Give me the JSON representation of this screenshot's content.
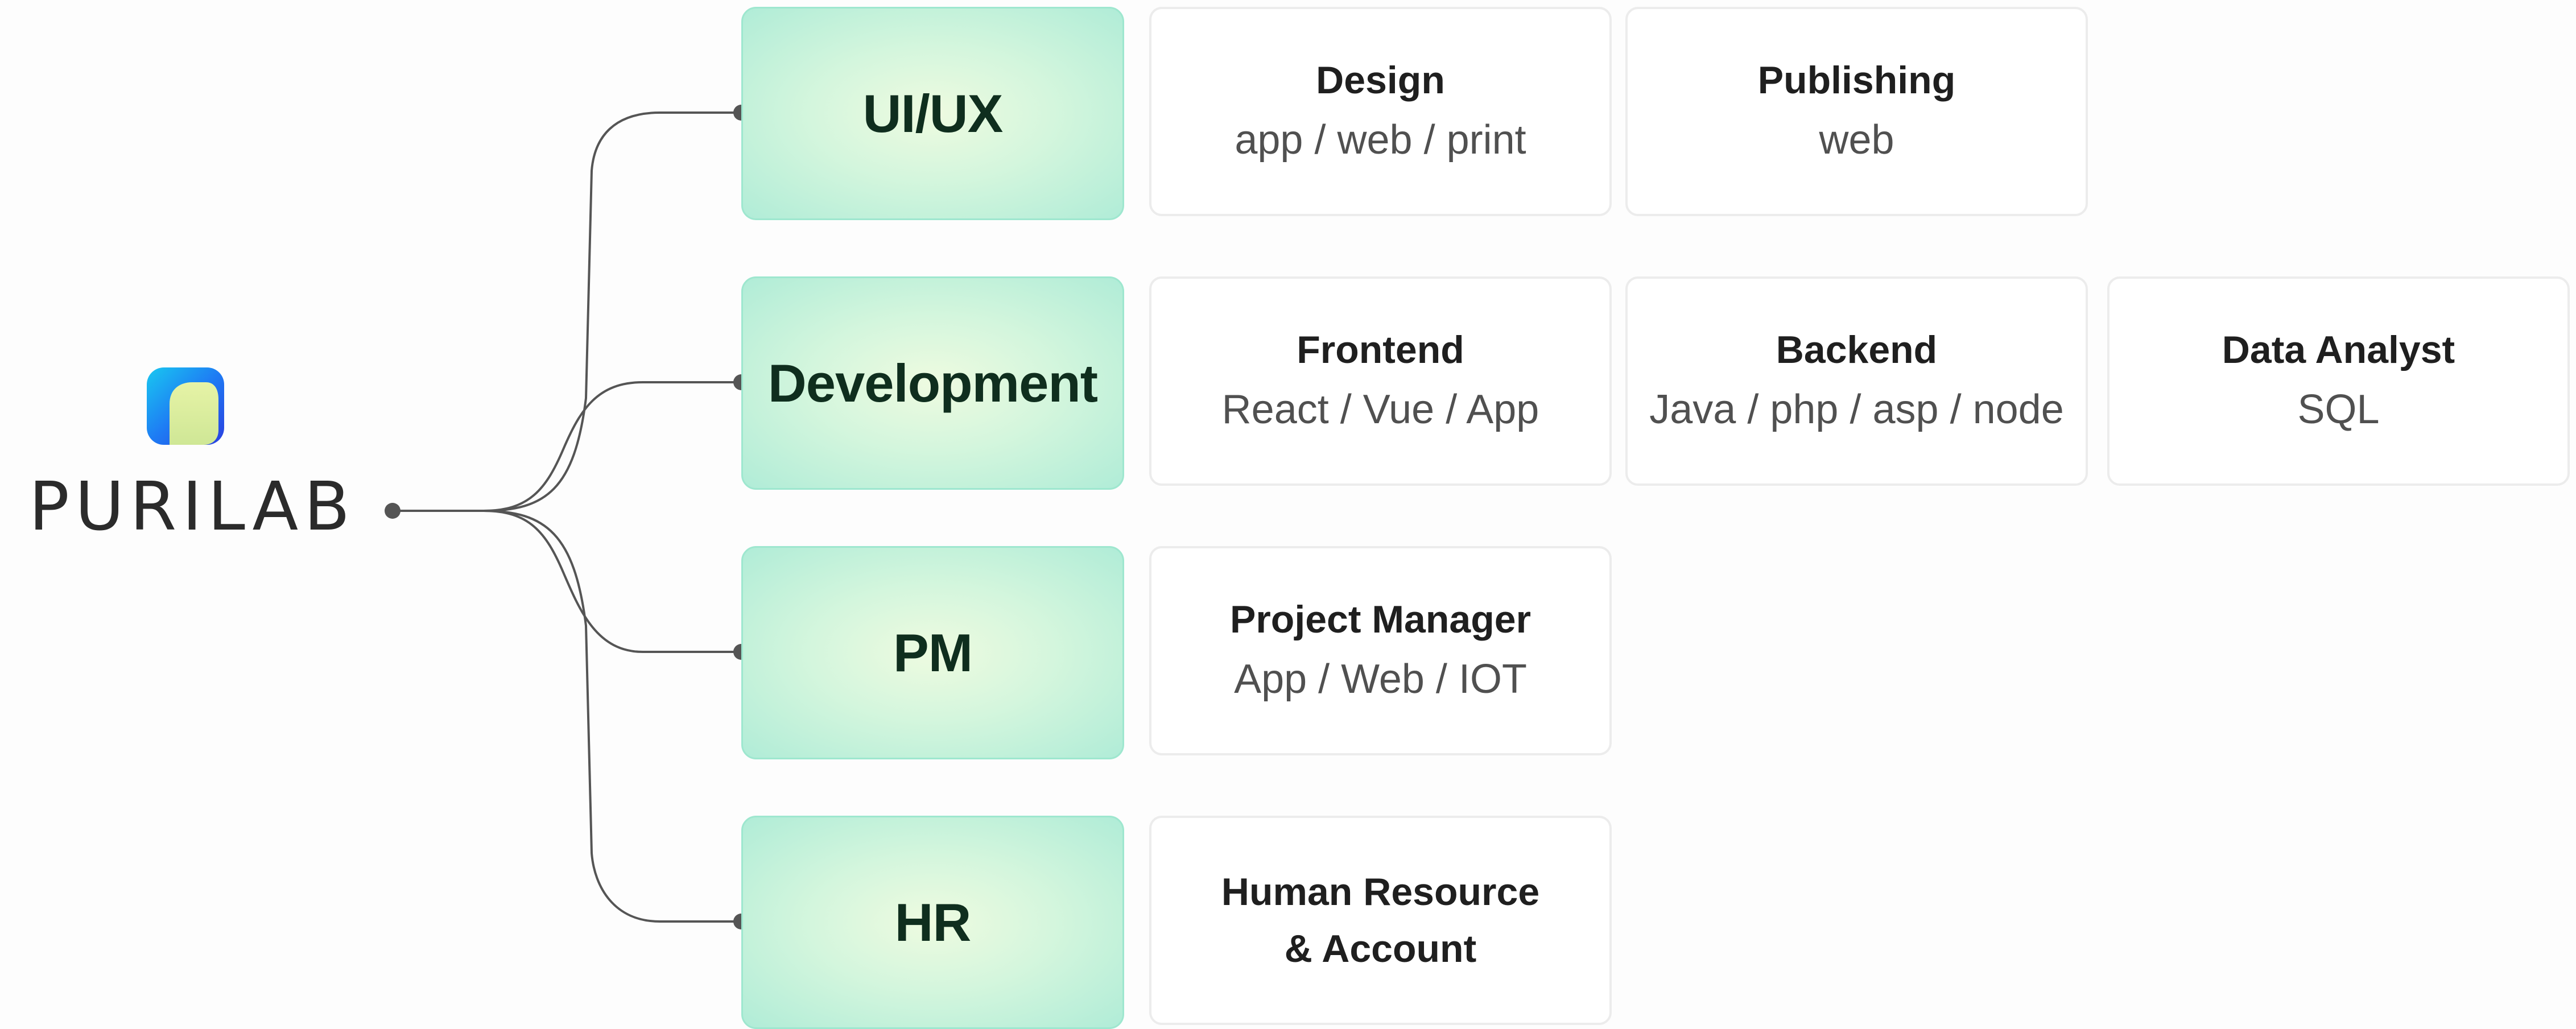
{
  "brand": {
    "name": "PURILAB",
    "logo_colors": {
      "outer": "#1e63f0",
      "inner": "#d9ee9a"
    }
  },
  "categories": [
    {
      "label": "UI/UX"
    },
    {
      "label": "Development"
    },
    {
      "label": "PM"
    },
    {
      "label": "HR"
    }
  ],
  "cards": {
    "design": {
      "title": "Design",
      "subtitle": "app / web / print"
    },
    "publishing": {
      "title": "Publishing",
      "subtitle": "web"
    },
    "frontend": {
      "title": "Frontend",
      "subtitle": "React / Vue / App"
    },
    "backend": {
      "title": "Backend",
      "subtitle": "Java / php / asp / node"
    },
    "data_analyst": {
      "title": "Data Analyst",
      "subtitle": "SQL"
    },
    "project_manager": {
      "title": "Project Manager",
      "subtitle": "App / Web / IOT"
    },
    "human_resource": {
      "title_line1": "Human Resource",
      "title_line2": "& Account"
    }
  },
  "colors": {
    "category_fill": "#d4f6dd",
    "category_border": "#9ee7cf",
    "category_text": "#0f2e1e",
    "connector": "#555555",
    "card_border": "#ececec"
  }
}
